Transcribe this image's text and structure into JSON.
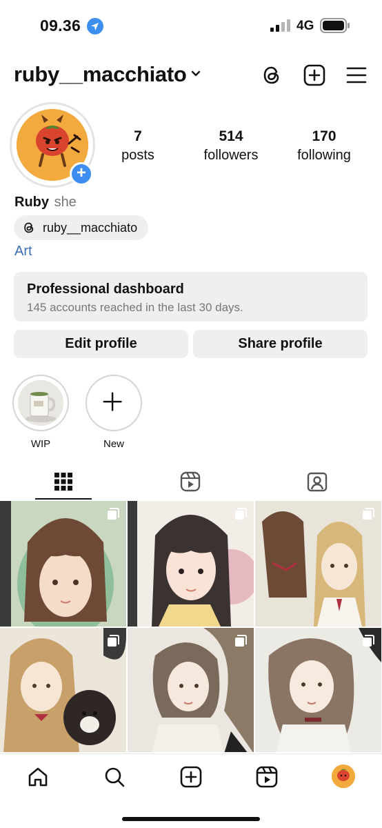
{
  "status_bar": {
    "time": "09.36",
    "network": "4G",
    "icons": [
      "location-arrow-icon",
      "signal-icon",
      "battery-icon"
    ]
  },
  "header": {
    "username": "ruby__macchiato",
    "icons": [
      "chevron-down-icon",
      "threads-icon",
      "create-post-icon",
      "menu-icon"
    ]
  },
  "profile": {
    "stats": [
      {
        "value": "7",
        "label": "posts"
      },
      {
        "value": "514",
        "label": "followers"
      },
      {
        "value": "170",
        "label": "following"
      }
    ],
    "name": "Ruby",
    "pronoun": "she",
    "threads_handle": "ruby__macchiato",
    "category": "Art"
  },
  "dashboard": {
    "title": "Professional dashboard",
    "subtitle": "145 accounts reached in the last 30 days."
  },
  "actions": {
    "edit": "Edit profile",
    "share": "Share profile"
  },
  "highlights": [
    {
      "label": "WIP"
    },
    {
      "label": "New"
    }
  ],
  "tabs": [
    "grid-icon",
    "reels-icon",
    "tagged-icon"
  ],
  "colors": {
    "accent_blue": "#3d8ef0",
    "link_blue": "#3a6fb8",
    "avatar_orange": "#f2a93d",
    "chip_gray": "#efefef"
  },
  "grid": {
    "posts": 6,
    "multi_image_indicator": true
  },
  "bottom_nav": [
    "home-icon",
    "search-icon",
    "create-icon",
    "reels-icon",
    "profile-avatar"
  ]
}
